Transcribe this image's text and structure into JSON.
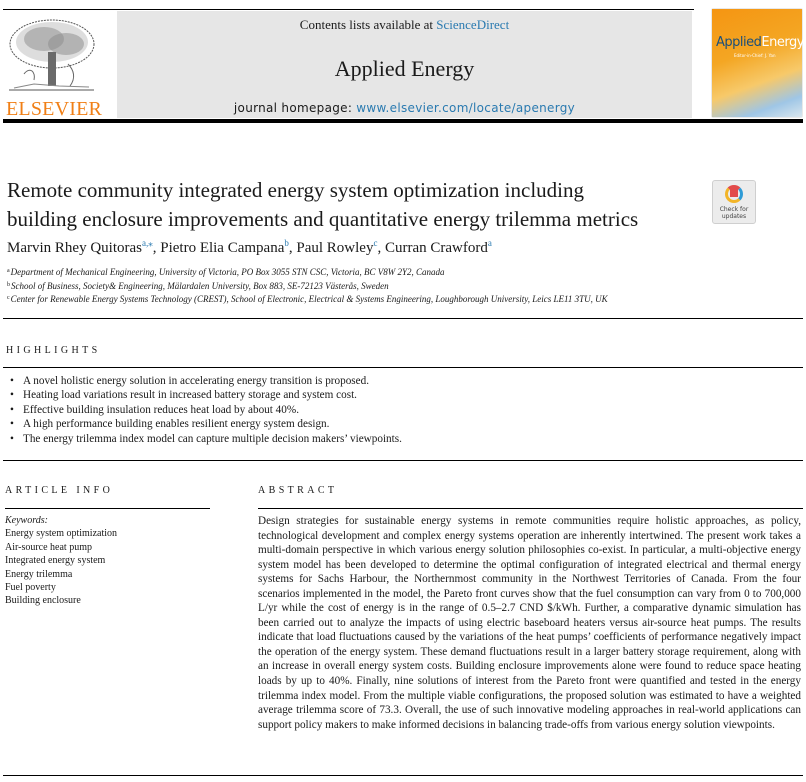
{
  "header": {
    "contents_prefix": "Contents lists available at ",
    "contents_link": "ScienceDirect",
    "journal_name": "Applied Energy",
    "homepage_prefix": "journal homepage: ",
    "homepage_url": "www.elsevier.com/locate/apenergy",
    "publisher_logo_text": "ELSEVIER",
    "cover_title_part1": "Applied",
    "cover_title_part2": "Energy",
    "cover_subtitle": "Editor-in-Chief: J. Yan"
  },
  "colors": {
    "link": "#2a7ab0",
    "elsevier_orange": "#f07f16",
    "header_bg": "#e6e6e6"
  },
  "article": {
    "title_line1": "Remote community integrated energy system optimization including",
    "title_line2": "building enclosure improvements and quantitative energy trilemma metrics",
    "check_updates_line1": "Check for",
    "check_updates_line2": "updates",
    "authors": [
      {
        "name": "Marvin Rhey Quitoras",
        "sup": "a,⁎",
        "sep": ", "
      },
      {
        "name": "Pietro Elia Campana",
        "sup": "b",
        "sep": ", "
      },
      {
        "name": "Paul Rowley",
        "sup": "c",
        "sep": ", "
      },
      {
        "name": "Curran Crawford",
        "sup": "a",
        "sep": ""
      }
    ],
    "affiliations": [
      {
        "sup": "a",
        "text": "Department of Mechanical Engineering, University of Victoria, PO Box 3055 STN CSC, Victoria, BC V8W 2Y2, Canada"
      },
      {
        "sup": "b",
        "text": "School of Business, Society& Engineering, Mälardalen University, Box 883, SE-72123 Västerås, Sweden"
      },
      {
        "sup": "c",
        "text": "Center for Renewable Energy Systems Technology (CREST), School of Electronic, Electrical & Systems Engineering, Loughborough University, Leics LE11 3TU, UK"
      }
    ]
  },
  "highlights": {
    "heading": "HIGHLIGHTS",
    "bullet": "•",
    "items": [
      "A novel holistic energy solution in accelerating energy transition is proposed.",
      "Heating load variations result in increased battery storage and system cost.",
      "Effective building insulation reduces heat load by about 40%.",
      "A high performance building enables resilient energy system design.",
      "The energy trilemma index model can capture multiple decision makers’ viewpoints."
    ]
  },
  "article_info": {
    "heading": "ARTICLE INFO",
    "keywords_label": "Keywords:",
    "keywords": [
      "Energy system optimization",
      "Air-source heat pump",
      "Integrated energy system",
      "Energy trilemma",
      "Fuel poverty",
      "Building enclosure"
    ]
  },
  "abstract": {
    "heading": "ABSTRACT",
    "text": "Design strategies for sustainable energy systems in remote communities require holistic approaches, as policy, technological development and complex energy systems operation are inherently intertwined. The present work takes a multi-domain perspective in which various energy solution philosophies co-exist. In particular, a multi-objective energy system model has been developed to determine the optimal configuration of integrated elec­trical and thermal energy systems for Sachs Harbour, the Northernmost community in the Northwest Territories of Canada. From the four scenarios implemented in the model, the Pareto front curves show that the fuel consumption can vary from 0 to 700,000 L/yr while the cost of energy is in the range of 0.5–2.7 CND $/kWh. Further, a comparative dynamic simulation has been carried out to analyze the impacts of using electric base­board heaters versus air-source heat pumps. The results indicate that load fluctuations caused by the variations of the heat pumps’ coefficients of performance negatively impact the operation of the energy system. These demand fluctuations result in a larger battery storage requirement, along with an increase in overall energy system costs. Building enclosure improvements alone were found to reduce space heating loads by up to 40%. Finally, nine solutions of interest from the Pareto front were quantified and tested in the energy trilemma index model. From the multiple viable configurations, the proposed solution was estimated to have a weighted average trilemma score of 73.3. Overall, the use of such innovative modeling approaches in real-world applications can support policy makers to make informed decisions in balancing trade-offs from various energy solution view­points."
  }
}
